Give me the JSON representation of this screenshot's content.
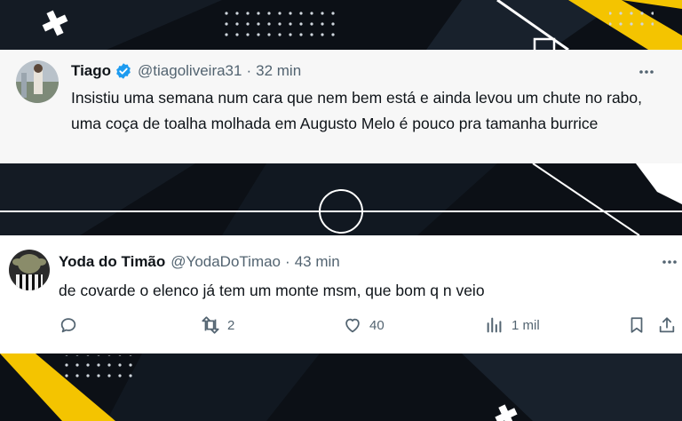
{
  "tweet_top": {
    "name": "Tiago",
    "handle": "@tiagoliveira31",
    "separator": "·",
    "time": "32 min",
    "text": "Insistiu uma semana num cara que nem bem está e ainda levou um chute no rabo, uma coça de toalha molhada em Augusto Melo é pouco pra tamanha burrice"
  },
  "tweet_bottom": {
    "name": "Yoda do Timão",
    "handle": "@YodaDoTimao",
    "separator": "·",
    "time": "43 min",
    "text": "de covarde o elenco já tem um monte msm, que bom q n veio",
    "actions": {
      "retweets": "2",
      "likes": "40",
      "views": "1 mil"
    }
  },
  "colors": {
    "accent_yellow": "#f4c400",
    "verified_blue": "#1d9bf0",
    "text_primary": "#0f1419",
    "text_secondary": "#536471",
    "background_dark": "#0c1016"
  },
  "icons": [
    "verified-badge-icon",
    "more-icon",
    "reply-icon",
    "retweet-icon",
    "like-icon",
    "views-icon",
    "bookmark-icon",
    "share-icon"
  ]
}
